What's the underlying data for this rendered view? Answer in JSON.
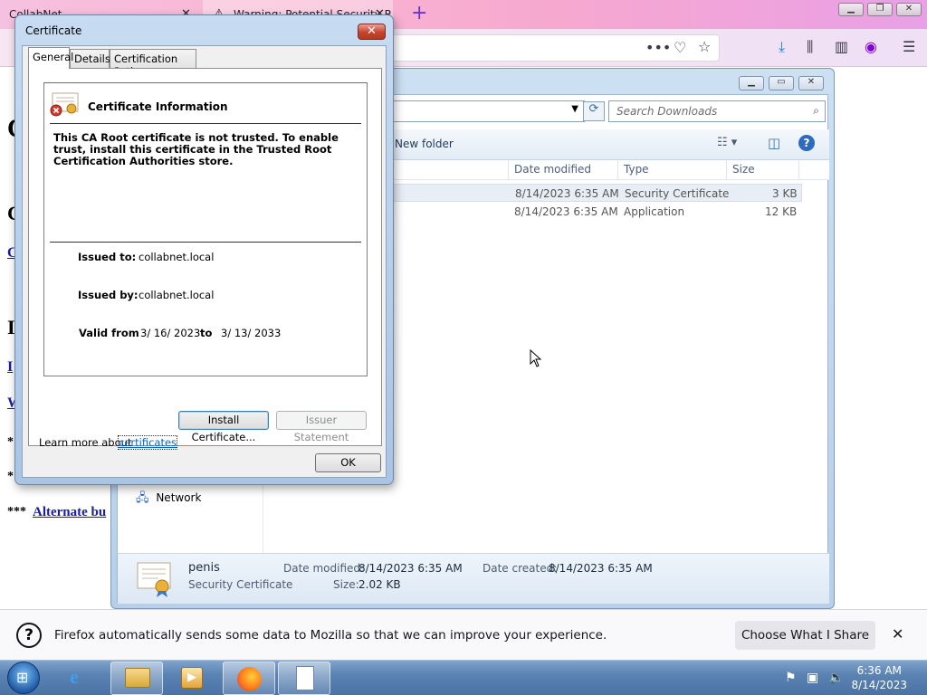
{
  "browser": {
    "tabs": [
      {
        "label": "CollabNet",
        "active": false
      },
      {
        "label": "Warning: Potential Security Risk",
        "active": true
      }
    ],
    "newtab_symbol": "+",
    "window_controls": [
      "minimize",
      "restore",
      "close"
    ]
  },
  "page": {
    "bg_fragments": [
      "C",
      "C",
      "C",
      "I",
      "I",
      "W",
      "*",
      "*"
    ],
    "bottom_prefix": "***",
    "bottom_link": "Alternate bu"
  },
  "explorer": {
    "search_placeholder": "Search Downloads",
    "toolbar_new_folder": "New folder",
    "columns": [
      "Date modified",
      "Type",
      "Size"
    ],
    "files": [
      {
        "date": "8/14/2023 6:35 AM",
        "type": "Security Certificate",
        "size": "3 KB",
        "selected": true
      },
      {
        "date": "8/14/2023 6:35 AM",
        "type": "Application",
        "size": "12 KB",
        "selected": false
      }
    ],
    "nav_network": "Network",
    "details": {
      "name": "penis",
      "type": "Security Certificate",
      "date_modified_label": "Date modified:",
      "date_modified": "8/14/2023 6:35 AM",
      "date_created_label": "Date created:",
      "date_created": "8/14/2023 6:35 AM",
      "size_label": "Size:",
      "size": "2.02 KB"
    }
  },
  "certificate": {
    "title": "Certificate",
    "tabs": [
      "General",
      "Details",
      "Certification Path"
    ],
    "info_heading": "Certificate Information",
    "warning": "This CA Root certificate is not trusted. To enable trust, install this certificate in the Trusted Root Certification Authorities store.",
    "issued_to_label": "Issued to:",
    "issued_to": "collabnet.local",
    "issued_by_label": "Issued by:",
    "issued_by": "collabnet.local",
    "valid_from_label": "Valid from",
    "valid_from": "3/ 16/ 2023",
    "valid_to_label": "to",
    "valid_to": "3/ 13/ 2033",
    "install_button": "Install Certificate...",
    "issuer_button": "Issuer Statement",
    "learn_more_prefix": "Learn more about",
    "learn_more_link": "certificates",
    "ok_button": "OK"
  },
  "notification": {
    "text": "Firefox automatically sends some data to Mozilla so that we can improve your experience.",
    "button": "Choose What I Share"
  },
  "taskbar": {
    "time": "6:36 AM",
    "date": "8/14/2023"
  },
  "colors": {
    "link": "#1a1aa6",
    "dialog_frame": "#aac4e4",
    "taskbar": "#5b83b3"
  }
}
